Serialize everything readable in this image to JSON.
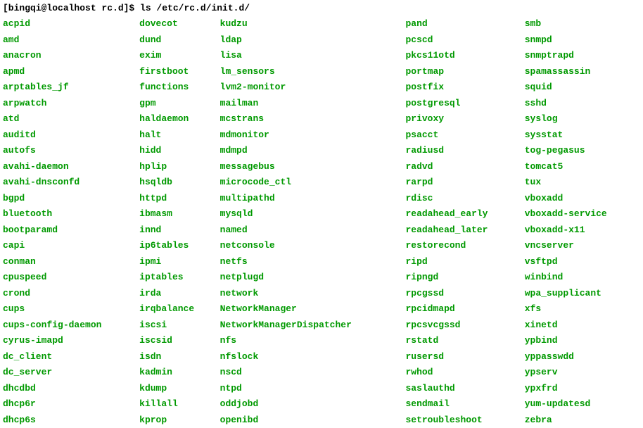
{
  "prompt": "[bingqi@localhost rc.d]$ ls /etc/rc.d/init.d/",
  "columns": [
    [
      "acpid",
      "amd",
      "anacron",
      "apmd",
      "arptables_jf",
      "arpwatch",
      "atd",
      "auditd",
      "autofs",
      "avahi-daemon",
      "avahi-dnsconfd",
      "bgpd",
      "bluetooth",
      "bootparamd",
      "capi",
      "conman",
      "cpuspeed",
      "crond",
      "cups",
      "cups-config-daemon",
      "cyrus-imapd",
      "dc_client",
      "dc_server",
      "dhcdbd",
      "dhcp6r",
      "dhcp6s"
    ],
    [
      "dovecot",
      "dund",
      "exim",
      "firstboot",
      "functions",
      "gpm",
      "haldaemon",
      "halt",
      "hidd",
      "hplip",
      "hsqldb",
      "httpd",
      "ibmasm",
      "innd",
      "ip6tables",
      "ipmi",
      "iptables",
      "irda",
      "irqbalance",
      "iscsi",
      "iscsid",
      "isdn",
      "kadmin",
      "kdump",
      "killall",
      "kprop"
    ],
    [
      "kudzu",
      "ldap",
      "lisa",
      "lm_sensors",
      "lvm2-monitor",
      "mailman",
      "mcstrans",
      "mdmonitor",
      "mdmpd",
      "messagebus",
      "microcode_ctl",
      "multipathd",
      "mysqld",
      "named",
      "netconsole",
      "netfs",
      "netplugd",
      "network",
      "NetworkManager",
      "NetworkManagerDispatcher",
      "nfs",
      "nfslock",
      "nscd",
      "ntpd",
      "oddjobd",
      "openibd"
    ],
    [
      "pand",
      "pcscd",
      "pkcs11otd",
      "portmap",
      "postfix",
      "postgresql",
      "privoxy",
      "psacct",
      "radiusd",
      "radvd",
      "rarpd",
      "rdisc",
      "readahead_early",
      "readahead_later",
      "restorecond",
      "ripd",
      "ripngd",
      "rpcgssd",
      "rpcidmapd",
      "rpcsvcgssd",
      "rstatd",
      "rusersd",
      "rwhod",
      "saslauthd",
      "sendmail",
      "setroubleshoot"
    ],
    [
      "smb",
      "snmpd",
      "snmptrapd",
      "spamassassin",
      "squid",
      "sshd",
      "syslog",
      "sysstat",
      "tog-pegasus",
      "tomcat5",
      "tux",
      "vboxadd",
      "vboxadd-service",
      "vboxadd-x11",
      "vncserver",
      "vsftpd",
      "winbind",
      "wpa_supplicant",
      "xfs",
      "xinetd",
      "ypbind",
      "yppasswdd",
      "ypserv",
      "ypxfrd",
      "yum-updatesd",
      "zebra"
    ]
  ]
}
